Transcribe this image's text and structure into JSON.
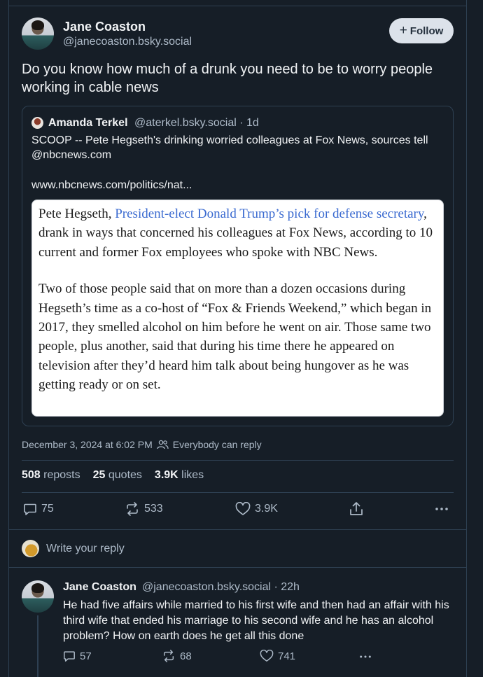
{
  "post": {
    "author_name": "Jane Coaston",
    "author_handle": "@janecoaston.bsky.social",
    "follow_label": "Follow",
    "text": "Do you know how much of a drunk you need to be to worry people working in cable news",
    "quote": {
      "author_name": "Amanda Terkel",
      "author_meta": "@aterkel.bsky.social · 1d",
      "text": "SCOOP -- Pete Hegseth's drinking worried colleagues at Fox News, sources tell @nbcnews.com",
      "link": "www.nbcnews.com/politics/nat...",
      "image": {
        "p1_before": "Pete Hegseth, ",
        "p1_link": "President-elect Donald Trump’s pick for defense secretary",
        "p1_after": ", drank in ways that concerned his colleagues at Fox News, according to 10 current and former Fox employees who spoke with NBC News.",
        "p2": "Two of those people said that on more than a dozen occasions during Hegseth’s time as a co-host of “Fox & Friends Weekend,” which began in 2017, they smelled alcohol on him before he went on air. Those same two people, plus another, said that during his time there he appeared on television after they’d heard him talk about being hungover as he was getting ready or on set."
      }
    },
    "timestamp": "December 3, 2024 at 6:02 PM",
    "reply_setting": "Everybody can reply",
    "stats": {
      "reposts_count": "508",
      "reposts_label": "reposts",
      "quotes_count": "25",
      "quotes_label": "quotes",
      "likes_count": "3.9K",
      "likes_label": "likes"
    },
    "actions": {
      "replies": "75",
      "reposts": "533",
      "likes": "3.9K"
    }
  },
  "reply_box": {
    "placeholder": "Write your reply"
  },
  "thread_reply": {
    "author_name": "Jane Coaston",
    "author_meta": "@janecoaston.bsky.social · 22h",
    "text": "He had five affairs while married to his first wife and then had an affair with his third wife that ended his marriage to his second wife and he has an alcohol problem? How on earth does he get all this done",
    "actions": {
      "replies": "57",
      "reposts": "68",
      "likes": "741"
    }
  },
  "colors": {
    "background": "#161e27",
    "border": "#2e4052",
    "muted_text": "#aebbc9",
    "link_blue": "#3a6ad0",
    "follow_bg": "#dce2ea"
  }
}
